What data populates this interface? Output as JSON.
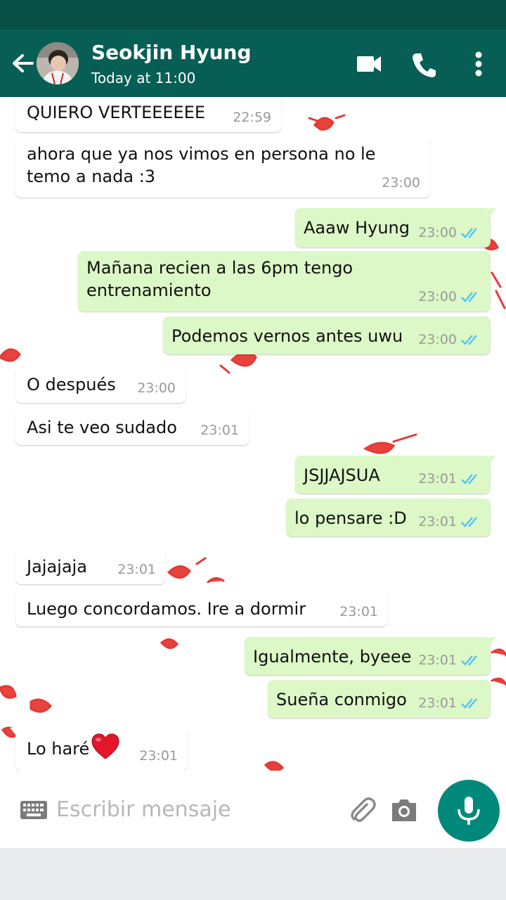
{
  "header": {
    "contact_name": "Seokjin Hyung",
    "last_seen": "Today at 11:00"
  },
  "colors": {
    "header": "#075e54",
    "status_bar": "#074e45",
    "outgoing_bubble": "#dcf8c6",
    "incoming_bubble": "#ffffff",
    "read_ticks": "#4fc3f7",
    "mic_button": "#00897b"
  },
  "messages": [
    {
      "dir": "in",
      "text": "QUIERO VERTEEEEEE",
      "time": "22:59"
    },
    {
      "dir": "in",
      "text": "ahora que ya nos vimos en persona no le temo a nada :3",
      "time": "23:00"
    },
    {
      "dir": "out",
      "text": "Aaaw Hyung",
      "time": "23:00",
      "status": "read"
    },
    {
      "dir": "out",
      "text": "Mañana recien a las 6pm tengo entrenamiento",
      "time": "23:00",
      "status": "read"
    },
    {
      "dir": "out",
      "text": "Podemos vernos antes uwu",
      "time": "23:00",
      "status": "read"
    },
    {
      "dir": "in",
      "text": "O después",
      "time": "23:00"
    },
    {
      "dir": "in",
      "text": "Asi te veo sudado",
      "time": "23:01"
    },
    {
      "dir": "out",
      "text": "JSJJAJSUA",
      "time": "23:01",
      "status": "read"
    },
    {
      "dir": "out",
      "text": "lo pensare :D",
      "time": "23:01",
      "status": "read"
    },
    {
      "dir": "in",
      "text": "Jajajaja",
      "time": "23:01"
    },
    {
      "dir": "in",
      "text": "Luego concordamos. Ire a dormir",
      "time": "23:01"
    },
    {
      "dir": "out",
      "text": "Igualmente, byeee",
      "time": "23:01",
      "status": "read"
    },
    {
      "dir": "out",
      "text": "Sueña conmigo",
      "time": "23:01",
      "status": "read"
    },
    {
      "dir": "in",
      "text": "Lo haré",
      "time": "23:01",
      "emoji": "red-heart"
    }
  ],
  "composer": {
    "placeholder": "Escribir mensaje"
  },
  "icons": {
    "back": "arrow-left-icon",
    "video": "videocam-icon",
    "call": "phone-icon",
    "menu": "more-vert-icon",
    "keyboard": "keyboard-icon",
    "attach": "paperclip-icon",
    "camera": "camera-icon",
    "mic": "mic-icon"
  }
}
